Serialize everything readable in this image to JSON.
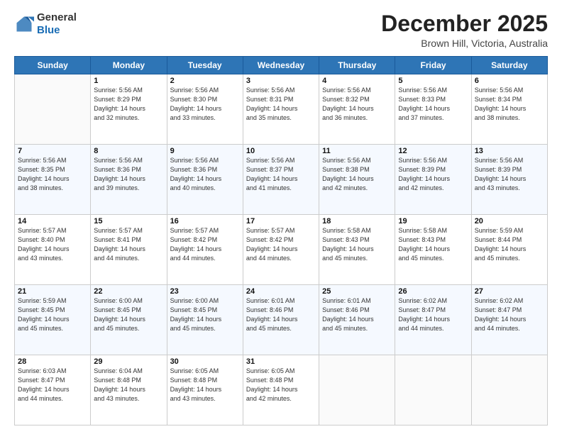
{
  "logo": {
    "general": "General",
    "blue": "Blue"
  },
  "header": {
    "month": "December 2025",
    "location": "Brown Hill, Victoria, Australia"
  },
  "days": [
    "Sunday",
    "Monday",
    "Tuesday",
    "Wednesday",
    "Thursday",
    "Friday",
    "Saturday"
  ],
  "weeks": [
    [
      {
        "num": "",
        "sunrise": "",
        "sunset": "",
        "daylight": ""
      },
      {
        "num": "1",
        "sunrise": "Sunrise: 5:56 AM",
        "sunset": "Sunset: 8:29 PM",
        "daylight": "Daylight: 14 hours and 32 minutes."
      },
      {
        "num": "2",
        "sunrise": "Sunrise: 5:56 AM",
        "sunset": "Sunset: 8:30 PM",
        "daylight": "Daylight: 14 hours and 33 minutes."
      },
      {
        "num": "3",
        "sunrise": "Sunrise: 5:56 AM",
        "sunset": "Sunset: 8:31 PM",
        "daylight": "Daylight: 14 hours and 35 minutes."
      },
      {
        "num": "4",
        "sunrise": "Sunrise: 5:56 AM",
        "sunset": "Sunset: 8:32 PM",
        "daylight": "Daylight: 14 hours and 36 minutes."
      },
      {
        "num": "5",
        "sunrise": "Sunrise: 5:56 AM",
        "sunset": "Sunset: 8:33 PM",
        "daylight": "Daylight: 14 hours and 37 minutes."
      },
      {
        "num": "6",
        "sunrise": "Sunrise: 5:56 AM",
        "sunset": "Sunset: 8:34 PM",
        "daylight": "Daylight: 14 hours and 38 minutes."
      }
    ],
    [
      {
        "num": "7",
        "sunrise": "Sunrise: 5:56 AM",
        "sunset": "Sunset: 8:35 PM",
        "daylight": "Daylight: 14 hours and 38 minutes."
      },
      {
        "num": "8",
        "sunrise": "Sunrise: 5:56 AM",
        "sunset": "Sunset: 8:36 PM",
        "daylight": "Daylight: 14 hours and 39 minutes."
      },
      {
        "num": "9",
        "sunrise": "Sunrise: 5:56 AM",
        "sunset": "Sunset: 8:36 PM",
        "daylight": "Daylight: 14 hours and 40 minutes."
      },
      {
        "num": "10",
        "sunrise": "Sunrise: 5:56 AM",
        "sunset": "Sunset: 8:37 PM",
        "daylight": "Daylight: 14 hours and 41 minutes."
      },
      {
        "num": "11",
        "sunrise": "Sunrise: 5:56 AM",
        "sunset": "Sunset: 8:38 PM",
        "daylight": "Daylight: 14 hours and 42 minutes."
      },
      {
        "num": "12",
        "sunrise": "Sunrise: 5:56 AM",
        "sunset": "Sunset: 8:39 PM",
        "daylight": "Daylight: 14 hours and 42 minutes."
      },
      {
        "num": "13",
        "sunrise": "Sunrise: 5:56 AM",
        "sunset": "Sunset: 8:39 PM",
        "daylight": "Daylight: 14 hours and 43 minutes."
      }
    ],
    [
      {
        "num": "14",
        "sunrise": "Sunrise: 5:57 AM",
        "sunset": "Sunset: 8:40 PM",
        "daylight": "Daylight: 14 hours and 43 minutes."
      },
      {
        "num": "15",
        "sunrise": "Sunrise: 5:57 AM",
        "sunset": "Sunset: 8:41 PM",
        "daylight": "Daylight: 14 hours and 44 minutes."
      },
      {
        "num": "16",
        "sunrise": "Sunrise: 5:57 AM",
        "sunset": "Sunset: 8:42 PM",
        "daylight": "Daylight: 14 hours and 44 minutes."
      },
      {
        "num": "17",
        "sunrise": "Sunrise: 5:57 AM",
        "sunset": "Sunset: 8:42 PM",
        "daylight": "Daylight: 14 hours and 44 minutes."
      },
      {
        "num": "18",
        "sunrise": "Sunrise: 5:58 AM",
        "sunset": "Sunset: 8:43 PM",
        "daylight": "Daylight: 14 hours and 45 minutes."
      },
      {
        "num": "19",
        "sunrise": "Sunrise: 5:58 AM",
        "sunset": "Sunset: 8:43 PM",
        "daylight": "Daylight: 14 hours and 45 minutes."
      },
      {
        "num": "20",
        "sunrise": "Sunrise: 5:59 AM",
        "sunset": "Sunset: 8:44 PM",
        "daylight": "Daylight: 14 hours and 45 minutes."
      }
    ],
    [
      {
        "num": "21",
        "sunrise": "Sunrise: 5:59 AM",
        "sunset": "Sunset: 8:45 PM",
        "daylight": "Daylight: 14 hours and 45 minutes."
      },
      {
        "num": "22",
        "sunrise": "Sunrise: 6:00 AM",
        "sunset": "Sunset: 8:45 PM",
        "daylight": "Daylight: 14 hours and 45 minutes."
      },
      {
        "num": "23",
        "sunrise": "Sunrise: 6:00 AM",
        "sunset": "Sunset: 8:45 PM",
        "daylight": "Daylight: 14 hours and 45 minutes."
      },
      {
        "num": "24",
        "sunrise": "Sunrise: 6:01 AM",
        "sunset": "Sunset: 8:46 PM",
        "daylight": "Daylight: 14 hours and 45 minutes."
      },
      {
        "num": "25",
        "sunrise": "Sunrise: 6:01 AM",
        "sunset": "Sunset: 8:46 PM",
        "daylight": "Daylight: 14 hours and 45 minutes."
      },
      {
        "num": "26",
        "sunrise": "Sunrise: 6:02 AM",
        "sunset": "Sunset: 8:47 PM",
        "daylight": "Daylight: 14 hours and 44 minutes."
      },
      {
        "num": "27",
        "sunrise": "Sunrise: 6:02 AM",
        "sunset": "Sunset: 8:47 PM",
        "daylight": "Daylight: 14 hours and 44 minutes."
      }
    ],
    [
      {
        "num": "28",
        "sunrise": "Sunrise: 6:03 AM",
        "sunset": "Sunset: 8:47 PM",
        "daylight": "Daylight: 14 hours and 44 minutes."
      },
      {
        "num": "29",
        "sunrise": "Sunrise: 6:04 AM",
        "sunset": "Sunset: 8:48 PM",
        "daylight": "Daylight: 14 hours and 43 minutes."
      },
      {
        "num": "30",
        "sunrise": "Sunrise: 6:05 AM",
        "sunset": "Sunset: 8:48 PM",
        "daylight": "Daylight: 14 hours and 43 minutes."
      },
      {
        "num": "31",
        "sunrise": "Sunrise: 6:05 AM",
        "sunset": "Sunset: 8:48 PM",
        "daylight": "Daylight: 14 hours and 42 minutes."
      },
      {
        "num": "",
        "sunrise": "",
        "sunset": "",
        "daylight": ""
      },
      {
        "num": "",
        "sunrise": "",
        "sunset": "",
        "daylight": ""
      },
      {
        "num": "",
        "sunrise": "",
        "sunset": "",
        "daylight": ""
      }
    ]
  ]
}
